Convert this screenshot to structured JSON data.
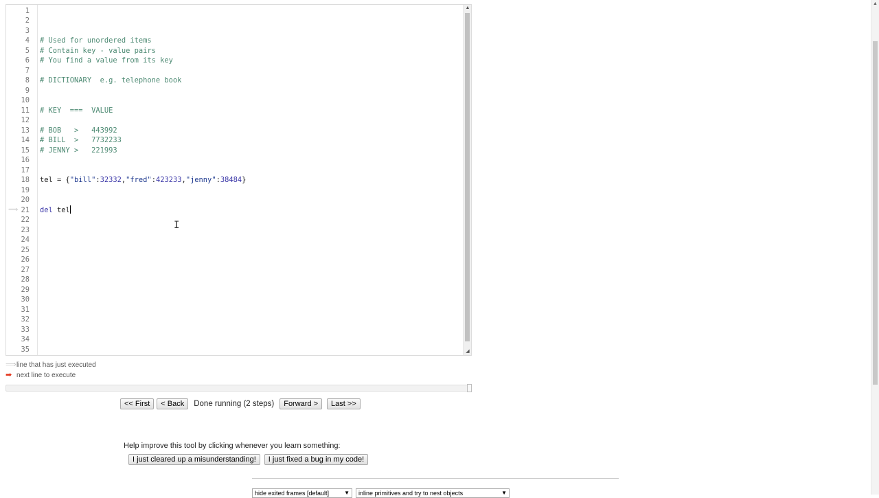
{
  "editor": {
    "lines": [
      {
        "n": "1",
        "segs": []
      },
      {
        "n": "2",
        "segs": []
      },
      {
        "n": "3",
        "segs": []
      },
      {
        "n": "4",
        "segs": [
          {
            "c": "cm-comment",
            "t": "# Used for unordered items"
          }
        ]
      },
      {
        "n": "5",
        "segs": [
          {
            "c": "cm-comment",
            "t": "# Contain key - value pairs"
          }
        ]
      },
      {
        "n": "6",
        "segs": [
          {
            "c": "cm-comment",
            "t": "# You find a value from its key"
          }
        ]
      },
      {
        "n": "7",
        "segs": []
      },
      {
        "n": "8",
        "segs": [
          {
            "c": "cm-comment",
            "t": "# DICTIONARY  e.g. telephone book"
          }
        ]
      },
      {
        "n": "9",
        "segs": []
      },
      {
        "n": "10",
        "segs": []
      },
      {
        "n": "11",
        "segs": [
          {
            "c": "cm-comment",
            "t": "# KEY  ===  VALUE"
          }
        ]
      },
      {
        "n": "12",
        "segs": []
      },
      {
        "n": "13",
        "segs": [
          {
            "c": "cm-comment",
            "t": "# BOB   >   443992"
          }
        ]
      },
      {
        "n": "14",
        "segs": [
          {
            "c": "cm-comment",
            "t": "# BILL  >   7732233"
          }
        ]
      },
      {
        "n": "15",
        "segs": [
          {
            "c": "cm-comment",
            "t": "# JENNY >   221993"
          }
        ]
      },
      {
        "n": "16",
        "segs": []
      },
      {
        "n": "17",
        "segs": []
      },
      {
        "n": "18",
        "segs": [
          {
            "c": "cm-var",
            "t": "tel = {"
          },
          {
            "c": "cm-str",
            "t": "\"bill\""
          },
          {
            "c": "cm-var",
            "t": ":"
          },
          {
            "c": "cm-num",
            "t": "32332"
          },
          {
            "c": "cm-var",
            "t": ","
          },
          {
            "c": "cm-str",
            "t": "\"fred\""
          },
          {
            "c": "cm-var",
            "t": ":"
          },
          {
            "c": "cm-num",
            "t": "423233"
          },
          {
            "c": "cm-var",
            "t": ","
          },
          {
            "c": "cm-str",
            "t": "\"jenny\""
          },
          {
            "c": "cm-var",
            "t": ":"
          },
          {
            "c": "cm-num",
            "t": "38484"
          },
          {
            "c": "cm-var",
            "t": "}"
          }
        ]
      },
      {
        "n": "19",
        "segs": []
      },
      {
        "n": "20",
        "segs": []
      },
      {
        "n": "21",
        "arrow": true,
        "caret": true,
        "segs": [
          {
            "c": "cm-keyword",
            "t": "del"
          },
          {
            "c": "cm-var",
            "t": " tel"
          }
        ]
      },
      {
        "n": "22",
        "segs": []
      },
      {
        "n": "23",
        "segs": []
      },
      {
        "n": "24",
        "segs": []
      },
      {
        "n": "25",
        "segs": []
      },
      {
        "n": "26",
        "segs": []
      },
      {
        "n": "27",
        "segs": []
      },
      {
        "n": "28",
        "segs": []
      },
      {
        "n": "29",
        "segs": []
      },
      {
        "n": "30",
        "segs": []
      },
      {
        "n": "31",
        "segs": []
      },
      {
        "n": "32",
        "segs": []
      },
      {
        "n": "33",
        "segs": []
      },
      {
        "n": "34",
        "segs": []
      },
      {
        "n": "35",
        "segs": []
      }
    ]
  },
  "legend": {
    "executed_label": "line that has just executed",
    "next_label": "next line to execute",
    "executed_arrow_color": "#c4c4c4",
    "next_arrow_color": "#e4371e"
  },
  "nav": {
    "first_label": "<< First",
    "back_label": "< Back",
    "status": "Done running (2 steps)",
    "forward_label": "Forward >",
    "last_label": "Last >>"
  },
  "help": {
    "prompt": "Help improve this tool by clicking whenever you learn something:",
    "misunderstanding_label": "I just cleared up a misunderstanding!",
    "bugfix_label": "I just fixed a bug in my code!"
  },
  "options": {
    "frames_select": "hide exited frames [default]",
    "primitives_select": "inline primitives and try to nest objects"
  }
}
